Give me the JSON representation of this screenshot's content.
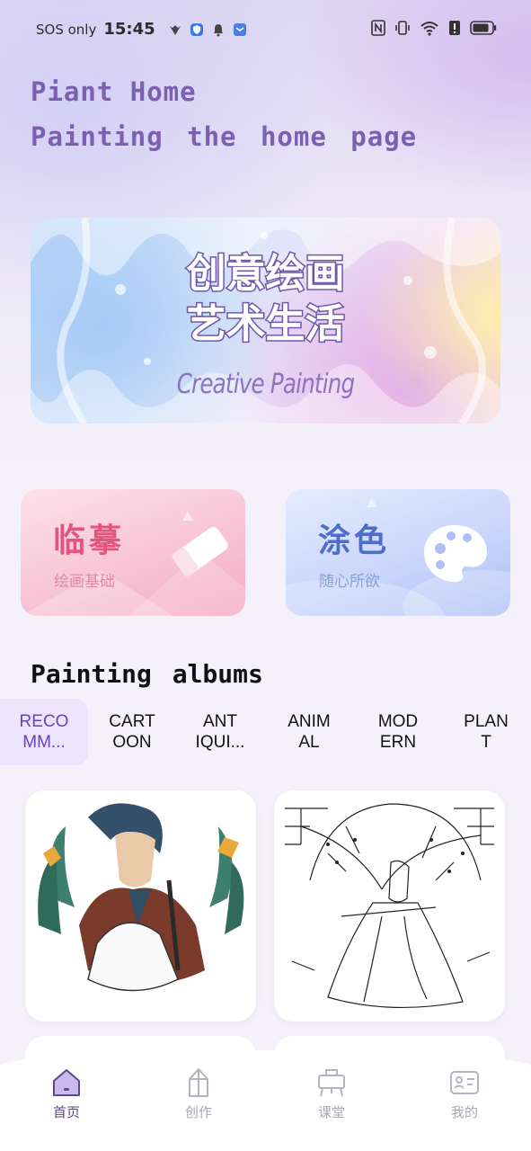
{
  "status_bar": {
    "carrier": "SOS only",
    "time": "15:45"
  },
  "header": {
    "line1": "Piant Home",
    "line2": "Painting the home page"
  },
  "banner": {
    "title_line1": "创意绘画",
    "title_line2": "艺术生活",
    "subtitle": "Creative Painting"
  },
  "cards": [
    {
      "title": "临摹",
      "subtitle": "绘画基础",
      "icon": "eraser-icon"
    },
    {
      "title": "涂色",
      "subtitle": "随心所欲",
      "icon": "palette-icon"
    }
  ],
  "albums": {
    "title": "Painting albums",
    "tabs": [
      {
        "label": "RECO\nMM...",
        "active": true
      },
      {
        "label": "CART\nOON",
        "active": false
      },
      {
        "label": "ANT\nIQUI...",
        "active": false
      },
      {
        "label": "ANIM\nAL",
        "active": false
      },
      {
        "label": "MOD\nERN",
        "active": false
      },
      {
        "label": "PLAN\nT",
        "active": false
      }
    ]
  },
  "bottom_nav": {
    "items": [
      {
        "label": "首页",
        "icon": "home-icon",
        "active": true
      },
      {
        "label": "创作",
        "icon": "pencil-icon",
        "active": false
      },
      {
        "label": "课堂",
        "icon": "easel-icon",
        "active": false
      },
      {
        "label": "我的",
        "icon": "profile-card-icon",
        "active": false
      }
    ]
  },
  "colors": {
    "accent": "#7b5fb0",
    "pink_card": "#f7c2d4",
    "blue_card": "#c7d4fb",
    "active_tab_bg": "#ece4fb"
  }
}
